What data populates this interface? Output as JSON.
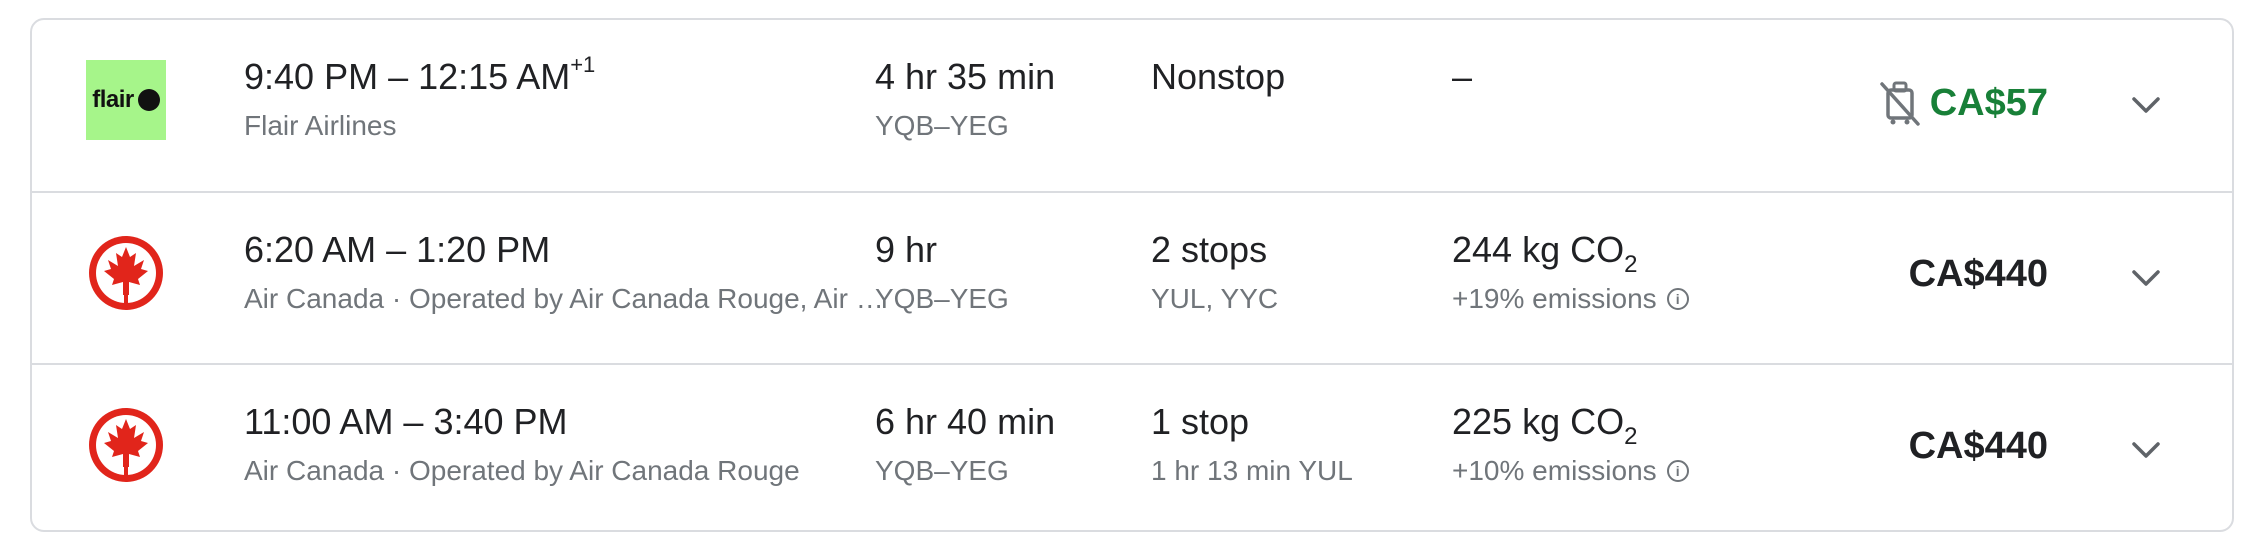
{
  "flights": [
    {
      "airline_logo": "flair-logo",
      "logo_text": "flair",
      "times": "9:40 PM – 12:15 AM",
      "day_offset": "+1",
      "airline": "Flair Airlines",
      "duration": "4 hr 35 min",
      "route": "YQB–YEG",
      "stops": "Nonstop",
      "stops_detail": "",
      "emissions": "–",
      "emissions_unit_sub": "",
      "emissions_detail": "",
      "price": "CA$57",
      "price_color": "#188038",
      "price_icon": "no-carry-on-bag-icon"
    },
    {
      "airline_logo": "air-canada-maple-leaf-logo",
      "times": "6:20 AM – 1:20 PM",
      "airline": "Air Canada · Operated by Air Canada Rouge, Air Canada Express - Jazz",
      "duration": "9 hr",
      "route": "YQB–YEG",
      "stops": "2 stops",
      "stops_detail": "YUL, YYC",
      "emissions": "244 kg CO",
      "emissions_unit_sub": "2",
      "emissions_detail": "+19% emissions",
      "price": "CA$440",
      "price_color": "#202124"
    },
    {
      "airline_logo": "air-canada-maple-leaf-logo",
      "times": "11:00 AM – 3:40 PM",
      "airline": "Air Canada · Operated by Air Canada Rouge",
      "duration": "6 hr 40 min",
      "route": "YQB–YEG",
      "stops": "1 stop",
      "stops_detail": "1 hr 13 min YUL",
      "emissions": "225 kg CO",
      "emissions_unit_sub": "2",
      "emissions_detail": "+10% emissions",
      "price": "CA$440",
      "price_color": "#202124"
    }
  ]
}
